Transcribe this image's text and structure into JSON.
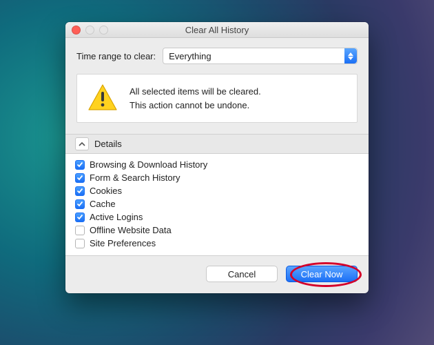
{
  "window": {
    "title": "Clear All History"
  },
  "time_range": {
    "label": "Time range to clear:",
    "selected": "Everything"
  },
  "warning": {
    "line1": "All selected items will be cleared.",
    "line2": "This action cannot be undone."
  },
  "details": {
    "header_label": "Details",
    "items": [
      {
        "label": "Browsing & Download History",
        "checked": true
      },
      {
        "label": "Form & Search History",
        "checked": true
      },
      {
        "label": "Cookies",
        "checked": true
      },
      {
        "label": "Cache",
        "checked": true
      },
      {
        "label": "Active Logins",
        "checked": true
      },
      {
        "label": "Offline Website Data",
        "checked": false
      },
      {
        "label": "Site Preferences",
        "checked": false
      }
    ]
  },
  "buttons": {
    "cancel": "Cancel",
    "clear_now": "Clear Now"
  },
  "annotation": {
    "highlight_clear_now": true
  }
}
